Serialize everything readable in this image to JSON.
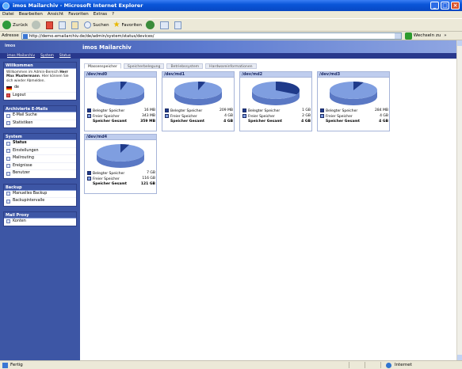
{
  "window": {
    "title": "imos Mailarchiv - Microsoft Internet Explorer"
  },
  "menubar": [
    "Datei",
    "Bearbeiten",
    "Ansicht",
    "Favoriten",
    "Extras",
    "?"
  ],
  "toolbar": {
    "back": "Zurück",
    "search": "Suchen",
    "favorites": "Favoriten"
  },
  "addressbar": {
    "label": "Adresse",
    "url": "http://demo.emailarchiv.de/de/admin/system/status/devices/",
    "go": "Wechseln zu",
    "links": "»"
  },
  "app": {
    "title": "imos Mailarchiv",
    "logo": "imos",
    "breadcrumb": [
      "imos Mailarchiv",
      "System",
      "Status"
    ]
  },
  "sidebar": {
    "welcome": {
      "header": "Willkommen",
      "text_pre": "Willkommen im Admin-Bereich ",
      "user": "Herr Max Mustermann",
      "text_post": ". Hier können Sie sich wieder Abmelden.",
      "lang": "de",
      "logout": "Logout"
    },
    "archived": {
      "header": "Archivierte E-Mails",
      "items": [
        "E-Mail Suche",
        "Statistiken"
      ]
    },
    "system": {
      "header": "System",
      "items": [
        "Status",
        "Einstellungen",
        "Mailrouting",
        "Ereignisse",
        "Benutzer"
      ]
    },
    "backup": {
      "header": "Backup",
      "items": [
        "Manuelles Backup",
        "Backupintervalle"
      ]
    },
    "proxy": {
      "header": "Mail Proxy",
      "items": [
        "Konten"
      ]
    }
  },
  "tabs": [
    "Massenspeicher",
    "Speicherbelegung",
    "Betriebssystem",
    "Hardwareinformationen"
  ],
  "labels": {
    "used": "Belegter Speicher",
    "free": "Freier Speicher",
    "total": "Speicher Gesamt"
  },
  "colors": {
    "used": "#1f3a8a",
    "free": "#7f9ee0",
    "header": "#3d56a5"
  },
  "devices": [
    {
      "name": "/dev/md0",
      "used": "16 MB",
      "free": "343 MB",
      "total": "359 MB",
      "used_fraction": 0.045
    },
    {
      "name": "/dev/md1",
      "used": "209 MB",
      "free": "4 GB",
      "total": "4 GB",
      "used_fraction": 0.05
    },
    {
      "name": "/dev/md2",
      "used": "1 GB",
      "free": "2 GB",
      "total": "4 GB",
      "used_fraction": 0.33
    },
    {
      "name": "/dev/md3",
      "used": "284 MB",
      "free": "4 GB",
      "total": "4 GB",
      "used_fraction": 0.07
    },
    {
      "name": "/dev/md4",
      "used": "7 GB",
      "free": "116 GB",
      "total": "121 GB",
      "used_fraction": 0.06
    }
  ],
  "status": {
    "left": "Fertig",
    "zone": "Internet"
  }
}
